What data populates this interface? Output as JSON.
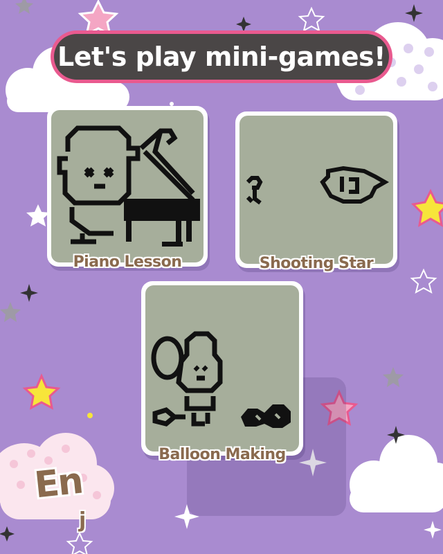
{
  "header": {
    "title": "Let's play mini-games!"
  },
  "games": [
    {
      "label": "Piano Lesson",
      "icon": "piano-character-icon"
    },
    {
      "label": "Shooting Star",
      "icon": "shooting-star-icon"
    },
    {
      "label": "Balloon Making",
      "icon": "balloon-character-icon"
    }
  ],
  "language": {
    "primary": "En",
    "secondary": "j"
  },
  "colors": {
    "background": "#a98bd0",
    "title_pill": "#4a4646",
    "title_border": "#e95a8f",
    "lcd_screen": "#a6ae9b",
    "label_text": "#8a6a4e",
    "star_pink": "#f4a6c4",
    "star_yellow": "#f7e53a"
  }
}
